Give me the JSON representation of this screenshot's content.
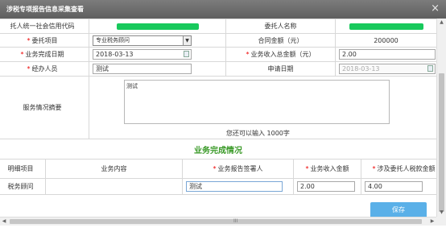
{
  "window": {
    "title": "涉税专项报告信息采集查看",
    "close_symbol": "×"
  },
  "form": {
    "row1": {
      "left_label": "托人统一社会信用代码",
      "right_label": "委托人名称"
    },
    "row2": {
      "left_label": "委托项目",
      "select_value": "专业税务顾问",
      "right_label": "合同金额（元）",
      "contract_amount": "200000"
    },
    "row3": {
      "left_label": "业务完成日期",
      "date_value": "2018-03-13",
      "right_label": "业务收入总金额（元）",
      "income_total": "2.00"
    },
    "row4": {
      "left_label": "经办人员",
      "handler_value": "测试",
      "right_label": "申请日期",
      "apply_date": "2018-03-13"
    },
    "row5": {
      "left_label": "服务情况摘要",
      "summary_value": "测试",
      "remaining_text": "您还可以输入 1000字"
    }
  },
  "section": {
    "title": "业务完成情况"
  },
  "grid": {
    "headers": {
      "col1": "明细项目",
      "col2": "业务内容",
      "col3": "业务报告签署人",
      "col4": "业务收入金额",
      "col5": "涉及委托人税款金额"
    },
    "row": {
      "col1": "税务顾问",
      "signer": "测试",
      "income": "2.00",
      "tax": "4.00"
    }
  },
  "actions": {
    "save_label": "保存"
  },
  "scroll": {
    "grip": "III"
  },
  "colors": {
    "accent_green": "#18c95c",
    "section_green": "#3a9a28",
    "save_blue": "#5ab0e8",
    "required_red": "#ee0000"
  }
}
